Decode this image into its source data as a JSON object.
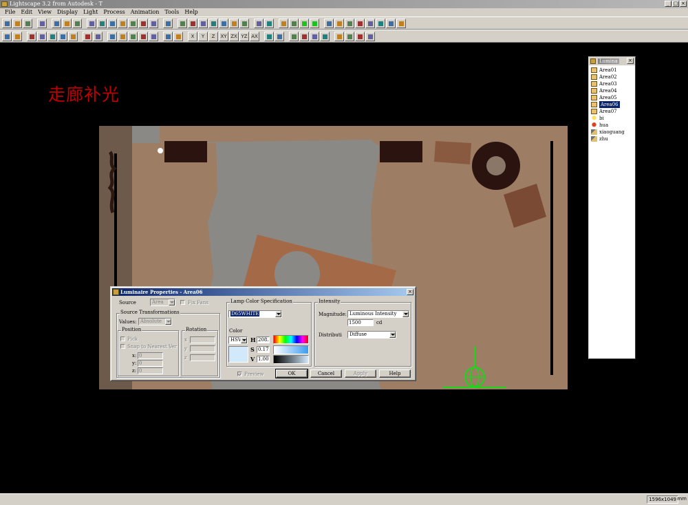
{
  "window": {
    "title": "Lightscape 3.2 from Autodesk - T"
  },
  "menu": [
    "File",
    "Edit",
    "View",
    "Display",
    "Light",
    "Process",
    "Animation",
    "Tools",
    "Help"
  ],
  "toolbar1": [
    {
      "name": "new-icon"
    },
    {
      "name": "open-icon"
    },
    {
      "name": "save-icon"
    },
    {
      "sep": true
    },
    {
      "name": "undo-icon"
    },
    {
      "sep": true
    },
    {
      "name": "print-icon"
    },
    {
      "name": "help-icon"
    },
    {
      "name": "context-help-icon"
    },
    {
      "sep": true
    },
    {
      "name": "select-object-icon"
    },
    {
      "name": "layer-icon"
    },
    {
      "name": "layer2-icon"
    },
    {
      "name": "layer3-icon"
    },
    {
      "name": "layer4-icon"
    },
    {
      "name": "layer5-icon"
    },
    {
      "name": "layer6-icon"
    },
    {
      "sep": true
    },
    {
      "name": "wireframe-icon"
    },
    {
      "sep": true
    },
    {
      "name": "orbit-icon"
    },
    {
      "name": "pan-icon"
    },
    {
      "name": "zoom-icon"
    },
    {
      "name": "zoom-window-icon"
    },
    {
      "name": "dolly-icon"
    },
    {
      "name": "roll-icon"
    },
    {
      "name": "walk-icon"
    },
    {
      "sep": true
    },
    {
      "name": "zoom-extents-icon"
    },
    {
      "name": "camera-icon"
    },
    {
      "sep": true
    },
    {
      "name": "shading-off-icon"
    },
    {
      "name": "shading-on-icon"
    },
    {
      "name": "render-green-icon"
    },
    {
      "name": "render-green2-icon"
    },
    {
      "sep": true
    },
    {
      "name": "process-icon"
    },
    {
      "name": "process2-icon"
    },
    {
      "name": "process3-icon"
    },
    {
      "name": "process4-icon"
    },
    {
      "name": "light-square-icon"
    },
    {
      "name": "globe-icon"
    },
    {
      "name": "report-icon"
    },
    {
      "name": "materials-icon"
    }
  ],
  "toolbar2": [
    {
      "name": "pointer-icon"
    },
    {
      "name": "select-icon"
    },
    {
      "sep": true
    },
    {
      "name": "select-surface-icon"
    },
    {
      "name": "select-surface2-icon"
    },
    {
      "name": "select-surface3-icon"
    },
    {
      "name": "select-surface4-icon"
    },
    {
      "name": "select-surface5-icon"
    },
    {
      "sep": true
    },
    {
      "name": "copy-icon"
    },
    {
      "name": "paste-icon"
    },
    {
      "sep": true
    },
    {
      "name": "block-icon"
    },
    {
      "name": "block2-icon"
    },
    {
      "name": "block3-icon"
    },
    {
      "name": "block4-icon"
    },
    {
      "name": "block5-icon"
    },
    {
      "sep": true
    },
    {
      "name": "move-icon"
    },
    {
      "name": "rotate-icon"
    },
    {
      "sep": true
    },
    {
      "name": "axis-x-icon",
      "label": "X"
    },
    {
      "name": "axis-y-icon",
      "label": "Y"
    },
    {
      "name": "axis-z-icon",
      "label": "Z"
    },
    {
      "name": "plane-xy-icon",
      "label": "XY"
    },
    {
      "name": "plane-zx-icon",
      "label": "ZX"
    },
    {
      "name": "plane-yz-icon",
      "label": "YZ"
    },
    {
      "name": "plane-axis-icon",
      "label": "AX"
    },
    {
      "sep": true
    },
    {
      "name": "snap-icon"
    },
    {
      "name": "snap2-icon"
    },
    {
      "sep": true
    },
    {
      "name": "tool-a-icon"
    },
    {
      "name": "tool-b-icon"
    },
    {
      "name": "tool-c-icon"
    },
    {
      "name": "tool-d-icon"
    },
    {
      "sep": true
    },
    {
      "name": "list-icon"
    },
    {
      "name": "globe2-icon"
    },
    {
      "name": "tool-e-icon"
    },
    {
      "name": "tool-f-icon"
    }
  ],
  "annotation": "走廊补光",
  "luminaires_panel": {
    "title": "Lumina",
    "items": [
      {
        "label": "Area01",
        "icon": "lamp"
      },
      {
        "label": "Area02",
        "icon": "lamp"
      },
      {
        "label": "Area03",
        "icon": "lamp"
      },
      {
        "label": "Area04",
        "icon": "lamp"
      },
      {
        "label": "Area05",
        "icon": "lamp"
      },
      {
        "label": "Area06",
        "icon": "lamp",
        "selected": true
      },
      {
        "label": "Area07",
        "icon": "lamp"
      },
      {
        "label": "bi",
        "icon": "bulb"
      },
      {
        "label": "hua",
        "icon": "bulb-red"
      },
      {
        "label": "xiaoguang",
        "icon": "spot"
      },
      {
        "label": "zhu",
        "icon": "spot"
      }
    ]
  },
  "dialog": {
    "title": "Luminaire Properties - Area06",
    "source_label": "Source",
    "source_value": "Area",
    "fix_fans_label": "Fix Fans",
    "source_transformations_title": "Source Transformations",
    "values_label": "Values:",
    "values_value": "Absolute",
    "position_title": "Position",
    "pick_label": "Pick",
    "snap_label": "Snap to Nearest Ver",
    "x_label": "x:",
    "y_label": "y:",
    "z_label": "z:",
    "x_value": "0",
    "y_value": "0",
    "z_value": "0",
    "rotation_title": "Rotation",
    "rot_x_label": "x",
    "rot_y_label": "y",
    "rot_z_label": "z",
    "lamp_color_title": "Lamp Color Specification",
    "lamp_color_value": "D65WHITE",
    "color_label": "Color",
    "color_model": "HSV",
    "h_label": "H",
    "s_label": "S",
    "v_label": "V",
    "h_value": "208.",
    "s_value": "0.17",
    "v_value": "1.00",
    "preview_label": "Preview",
    "intensity_title": "Intensity",
    "magnitude_label": "Magnitude:",
    "magnitude_value": "Luminous Intensity",
    "intensity_value": "1500",
    "intensity_unit": "cd",
    "distribution_label": "Distributi",
    "distribution_value": "Diffuse",
    "ok_label": "OK",
    "cancel_label": "Cancel",
    "apply_label": "Apply",
    "help_label": "Help",
    "colors": {
      "swatch": "#d2e9fb"
    }
  },
  "status": {
    "resolution": "1596x1049",
    "unit": "mm"
  }
}
